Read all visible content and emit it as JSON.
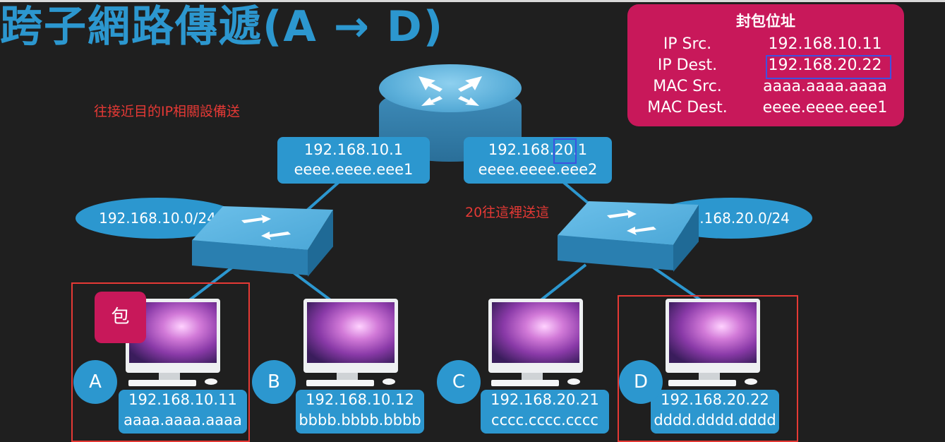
{
  "title": "跨子網路傳遞(A → D)",
  "annotations": {
    "note1": "往接近目的IP相關設備送",
    "note2": "20往這裡送這"
  },
  "packet": {
    "heading": "封包位址",
    "rows": [
      {
        "label": "IP Src.",
        "value": "192.168.10.11"
      },
      {
        "label": "IP Dest.",
        "value": "192.168.20.22"
      },
      {
        "label": "MAC Src.",
        "value": "aaaa.aaaa.aaaa"
      },
      {
        "label": "MAC Dest.",
        "value": "eeee.eeee.eee1"
      }
    ]
  },
  "router": {
    "left_iface": {
      "ip": "192.168.10.1",
      "mac": "eeee.eeee.eee1"
    },
    "right_iface": {
      "ip_prefix": "192.168.",
      "ip_highlight": "20",
      "ip_suffix": ".1",
      "mac": "eeee.eeee.eee2"
    }
  },
  "subnets": {
    "left": "192.168.10.0/24",
    "right": "192.168.20.0/24"
  },
  "hosts": [
    {
      "letter": "A",
      "ip": "192.168.10.11",
      "mac": "aaaa.aaaa.aaaa"
    },
    {
      "letter": "B",
      "ip": "192.168.10.12",
      "mac": "bbbb.bbbb.bbbb"
    },
    {
      "letter": "C",
      "ip": "192.168.20.21",
      "mac": "cccc.cccc.cccc"
    },
    {
      "letter": "D",
      "ip": "192.168.20.22",
      "mac": "dddd.dddd.dddd"
    }
  ],
  "packet_badge": "包",
  "colors": {
    "accent_blue": "#2c97cf",
    "packet_magenta": "#c8185a",
    "annotation_red": "#e53935",
    "highlight_blue": "#3f51e0"
  }
}
